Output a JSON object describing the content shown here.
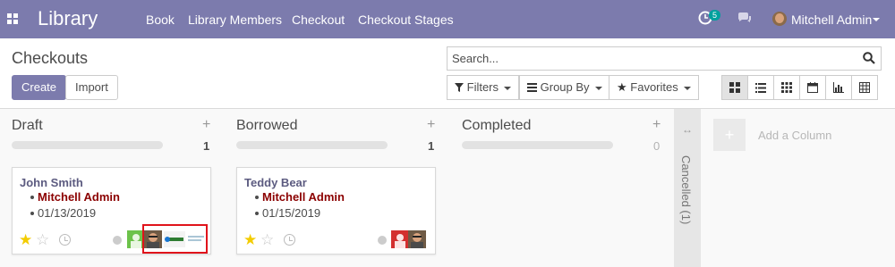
{
  "navbar": {
    "app_title": "Library",
    "menus": [
      "Book",
      "Library Members",
      "Checkout",
      "Checkout Stages"
    ],
    "activity_count": "5",
    "user": "Mitchell Admin",
    "bg_color": "#7c7bad"
  },
  "control_panel": {
    "breadcrumb": "Checkouts",
    "create_label": "Create",
    "import_label": "Import",
    "search_placeholder": "Search...",
    "filters_label": "Filters",
    "groupby_label": "Group By",
    "favorites_label": "Favorites",
    "views": [
      "kanban-icon",
      "list-icon",
      "grid-icon",
      "calendar-icon",
      "graph-icon",
      "pivot-icon"
    ],
    "active_view": "kanban-icon"
  },
  "kanban": {
    "columns": [
      {
        "title": "Draft",
        "count": "1"
      },
      {
        "title": "Borrowed",
        "count": "1"
      },
      {
        "title": "Completed",
        "count": "0"
      }
    ],
    "cards": [
      {
        "title": "John Smith",
        "user": "Mitchell Admin",
        "date": "01/13/2019",
        "starred": true
      },
      {
        "title": "Teddy Bear",
        "user": "Mitchell Admin",
        "date": "01/15/2019",
        "starred": true
      }
    ],
    "folded_column": "Cancelled (1)",
    "add_column_label": "Add a Column",
    "highlight_color": "#e0131b",
    "card_title_color": "#5c5b80",
    "user_text_color": "#8b0000"
  }
}
